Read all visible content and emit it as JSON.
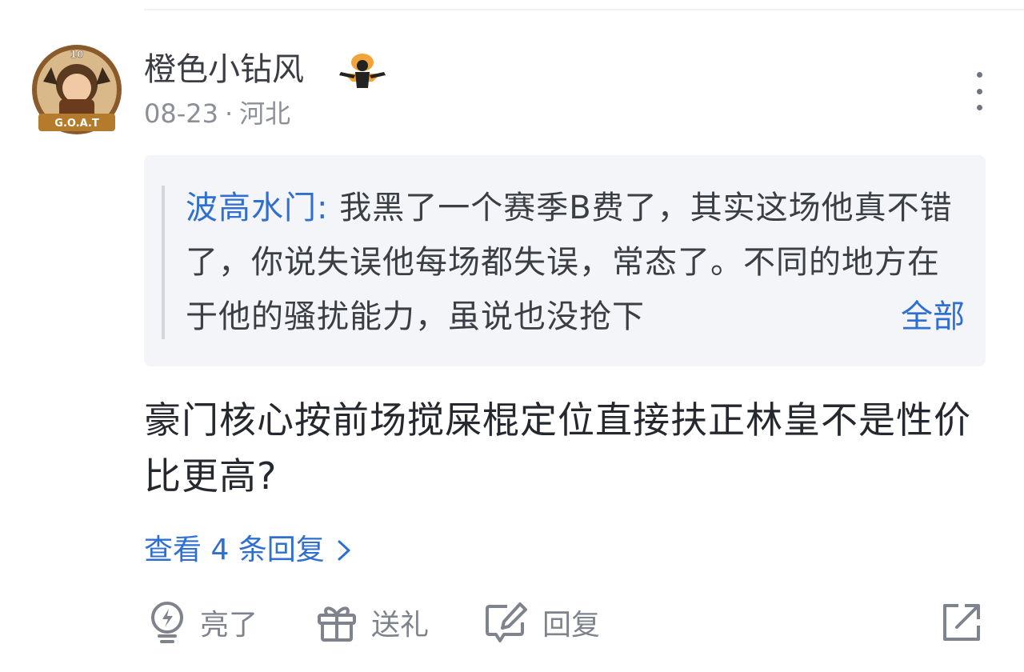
{
  "comment": {
    "author": {
      "name": "橙色小钻风",
      "avatar_icon": "goat-avatar-icon",
      "avatar_text": "G.O.A.T",
      "badge_icon": "dunk-player-badge-icon"
    },
    "meta": {
      "date": "08-23",
      "separator": "·",
      "location": "河北"
    },
    "quote": {
      "author": "波高水门:",
      "text": "我黑了一个赛季B费了，其实这场他真不错了，你说失误他每场都失误，常态了。不同的地方在于他的骚扰能力，虽说也没抢下",
      "more_label": "全部"
    },
    "body": "豪门核心按前场搅屎棍定位直接扶正林皇不是性价比更高?",
    "view_replies_label": "查看 4 条回复"
  },
  "actions": {
    "like_label": "亮了",
    "gift_label": "送礼",
    "reply_label": "回复"
  },
  "colors": {
    "link_blue": "#2f6fd2",
    "text_primary": "#25282e",
    "text_secondary": "#8b8f98",
    "quote_bg": "#f4f5f8"
  }
}
